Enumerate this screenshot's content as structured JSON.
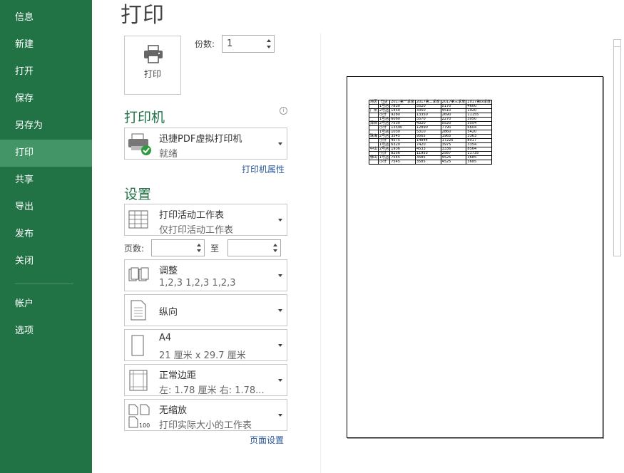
{
  "sidebar": {
    "items": [
      {
        "label": "信息"
      },
      {
        "label": "新建"
      },
      {
        "label": "打开"
      },
      {
        "label": "保存"
      },
      {
        "label": "另存为"
      },
      {
        "label": "打印"
      },
      {
        "label": "共享"
      },
      {
        "label": "导出"
      },
      {
        "label": "发布"
      },
      {
        "label": "关闭"
      },
      {
        "label": "帐户"
      },
      {
        "label": "选项"
      }
    ],
    "active_item": "打印"
  },
  "title": "打印",
  "print_button": {
    "label": "打印",
    "icon": "printer-icon"
  },
  "copies": {
    "label": "份数:",
    "value": "1"
  },
  "printer": {
    "heading": "打印机",
    "name": "迅捷PDF虚拟打印机",
    "status": "就绪",
    "properties_link": "打印机属性",
    "info_icon": "info-icon"
  },
  "settings": {
    "heading": "设置",
    "what": {
      "line1": "打印活动工作表",
      "line2": "仅打印活动工作表"
    },
    "pages": {
      "label": "页数:",
      "to_label": "至",
      "from_value": "",
      "to_value": ""
    },
    "collate": {
      "line1": "调整",
      "line2": "1,2,3    1,2,3    1,2,3"
    },
    "orientation": {
      "line1": "纵向"
    },
    "paper": {
      "line1": "A4",
      "line2": "21 厘米 x 29.7 厘米"
    },
    "margins": {
      "line1": "正常边距",
      "line2": "左:  1.78 厘米    右:  1.78..."
    },
    "scaling": {
      "line1": "无缩放",
      "line2": "打印实际大小的工作表",
      "icon_text": "100"
    },
    "page_setup_link": "页面设置"
  },
  "preview": {
    "headers": [
      "地区",
      "分店",
      "2017第一季度",
      "2017第二季度",
      "2017第三季度",
      "2017第四季度"
    ],
    "rows": [
      [
        "",
        "1号店",
        "7830",
        "5520",
        "5170",
        "4600"
      ],
      [
        "广州",
        "2号店",
        "1450",
        "3350",
        "4510",
        "1920"
      ],
      [
        "",
        "小计",
        "9280",
        "13350",
        "2690",
        "11155"
      ],
      [
        "",
        "1号店",
        "6060",
        "5570",
        "2270",
        "3050"
      ],
      [
        "深圳",
        "2号店",
        "7530",
        "4320",
        "5520",
        "3554"
      ],
      [
        "",
        "小计",
        "13590",
        "12890",
        "7790",
        "6604"
      ],
      [
        "",
        "1号店",
        "1030",
        "5310",
        "2860",
        "5420"
      ],
      [
        "珠海",
        "2号店",
        "3545",
        "9565",
        "1965",
        "3363"
      ],
      [
        "",
        "小计",
        "4575",
        "14844",
        "17225",
        "8017"
      ],
      [
        "",
        "1号店",
        "6320",
        "7420",
        "3975",
        "3354"
      ],
      [
        "中山",
        "2号店",
        "1936",
        "4533",
        "3336",
        "8564"
      ],
      [
        "",
        "小计",
        "8256",
        "11953",
        "2587",
        "11735"
      ],
      [
        "佛山",
        "1号店",
        "7545",
        "3585",
        "4525",
        "3685"
      ],
      [
        "",
        "小计",
        "7545",
        "3585",
        "4525",
        "3685"
      ]
    ]
  }
}
